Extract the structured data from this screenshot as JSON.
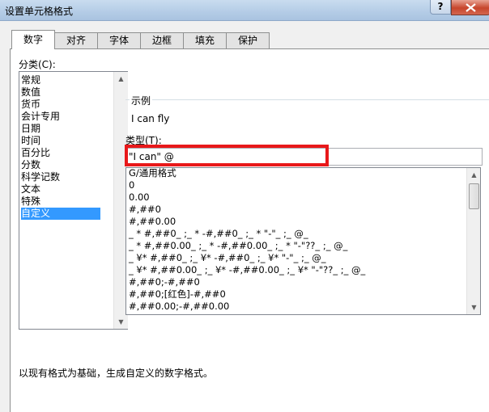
{
  "window": {
    "title": "设置单元格格式",
    "help_label": "?"
  },
  "tabs": [
    "数字",
    "对齐",
    "字体",
    "边框",
    "填充",
    "保护"
  ],
  "category": {
    "label": "分类(C):",
    "items": [
      "常规",
      "数值",
      "货币",
      "会计专用",
      "日期",
      "时间",
      "百分比",
      "分数",
      "科学记数",
      "文本",
      "特殊",
      "自定义"
    ],
    "selected": "自定义"
  },
  "sample": {
    "label": "示例",
    "value": "I can fly"
  },
  "type": {
    "label": "类型(T):",
    "value": "\"I can\" @",
    "formats": [
      "G/通用格式",
      "0",
      "0.00",
      "#,##0",
      "#,##0.00",
      "_ * #,##0_ ;_ * -#,##0_ ;_ * \"-\"_ ;_ @_",
      "_ * #,##0.00_ ;_ * -#,##0.00_ ;_ * \"-\"??_ ;_ @_",
      "_ ¥* #,##0_ ;_ ¥* -#,##0_ ;_ ¥* \"-\"_ ;_ @_",
      "_ ¥* #,##0.00_ ;_ ¥* -#,##0.00_ ;_ ¥* \"-\"??_ ;_ @_",
      "#,##0;-#,##0",
      "#,##0;[红色]-#,##0",
      "#,##0.00;-#,##0.00"
    ]
  },
  "description": "以现有格式为基础，生成自定义的数字格式。",
  "colors": {
    "selection": "#3399ff",
    "highlight": "#e8181a"
  }
}
